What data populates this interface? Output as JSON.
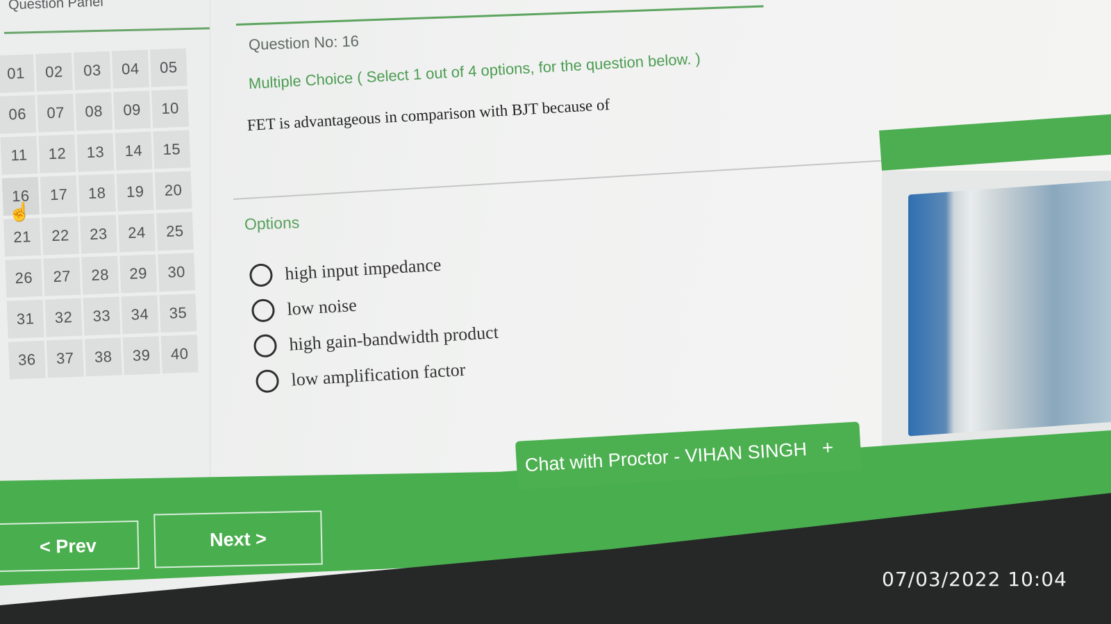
{
  "question_panel": {
    "title": "Question Panel",
    "numbers": [
      "01",
      "02",
      "03",
      "04",
      "05",
      "06",
      "07",
      "08",
      "09",
      "10",
      "11",
      "12",
      "13",
      "14",
      "15",
      "16",
      "17",
      "18",
      "19",
      "20",
      "21",
      "22",
      "23",
      "24",
      "25",
      "26",
      "27",
      "28",
      "29",
      "30",
      "31",
      "32",
      "33",
      "34",
      "35",
      "36",
      "37",
      "38",
      "39",
      "40"
    ],
    "current": "16"
  },
  "question": {
    "number_label": "Question No: 16",
    "type_label": "Multiple Choice ( Select 1 out of 4 options, for the question below. )",
    "text": "FET is advantageous in comparison with BJT because of"
  },
  "options": {
    "label": "Options",
    "items": [
      "high input impedance",
      "low noise",
      "high gain-bandwidth product",
      "low amplification factor"
    ]
  },
  "chat": {
    "label": "Chat with Proctor - VIHAN SINGH",
    "plus": "+"
  },
  "nav": {
    "prev": "< Prev",
    "next": "Next >"
  },
  "timestamp": "07/03/2022 10:04",
  "colors": {
    "accent_green": "#4caf50",
    "text_green": "#4c9c52"
  }
}
